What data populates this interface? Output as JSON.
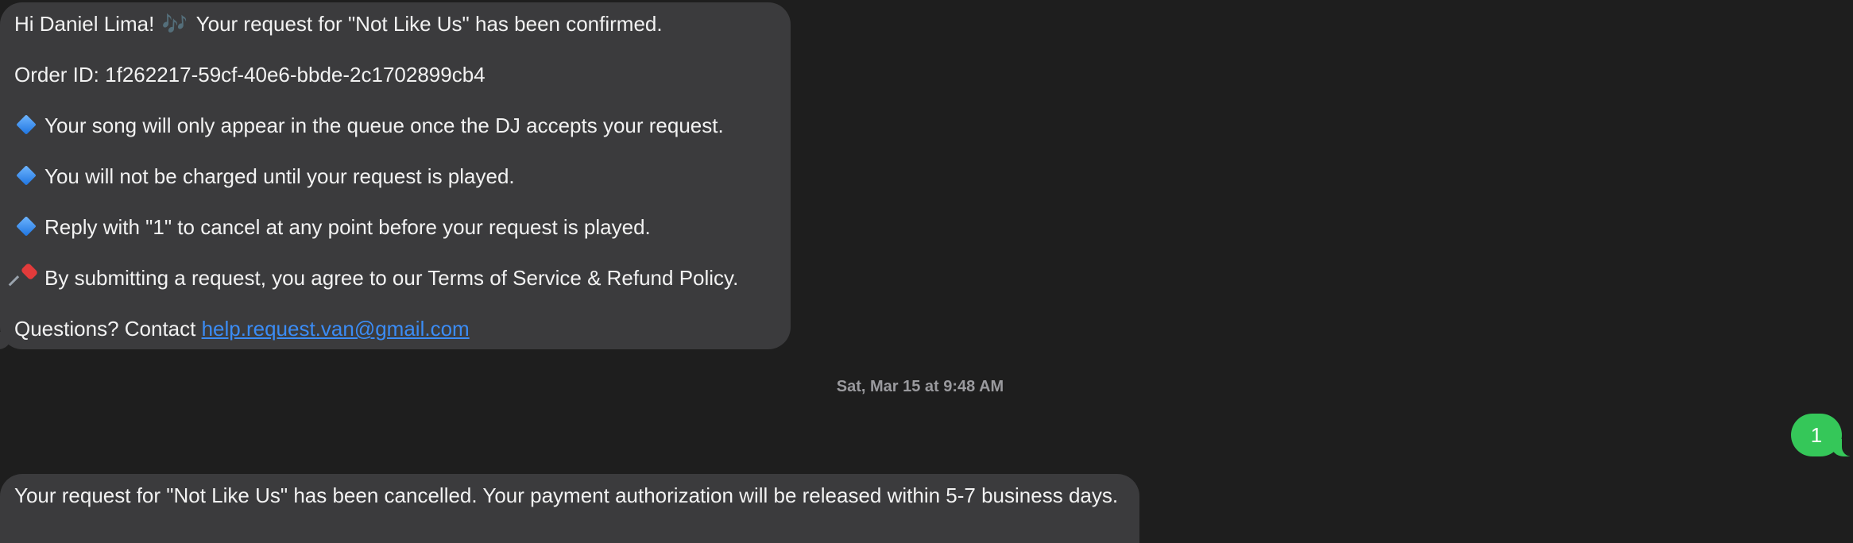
{
  "thread": {
    "received_1": {
      "greeting": "Hi Daniel Lima!",
      "greeting_emoji": "🎶",
      "greeting_rest": "Your request for \"Not Like Us\" has been confirmed.",
      "order_id": "Order ID: 1f262217-59cf-40e6-bbde-2c1702899cb4",
      "bullets": [
        "Your song will only appear in the queue once the DJ accepts your request.",
        "You will not be charged until your request is played.",
        "Reply with \"1\" to cancel at any point before your request is played."
      ],
      "bullet_icon": "blue-diamond-icon",
      "terms": "By submitting a request, you agree to our Terms of Service & Refund Policy.",
      "terms_icon": "pushpin-icon",
      "contact_prefix": "Questions? Contact ",
      "contact_email": "help.request.van@gmail.com"
    },
    "timestamp": "Sat, Mar 15 at 9:48 AM",
    "sent_1": {
      "text": "1"
    },
    "received_2": {
      "text": "Your request for \"Not Like Us\" has been cancelled. Your payment authorization will be released within 5-7 business days."
    }
  },
  "colors": {
    "background": "#1e1e1e",
    "incoming_bubble": "#3b3b3d",
    "outgoing_bubble": "#35c759",
    "link": "#3b8cf5"
  }
}
